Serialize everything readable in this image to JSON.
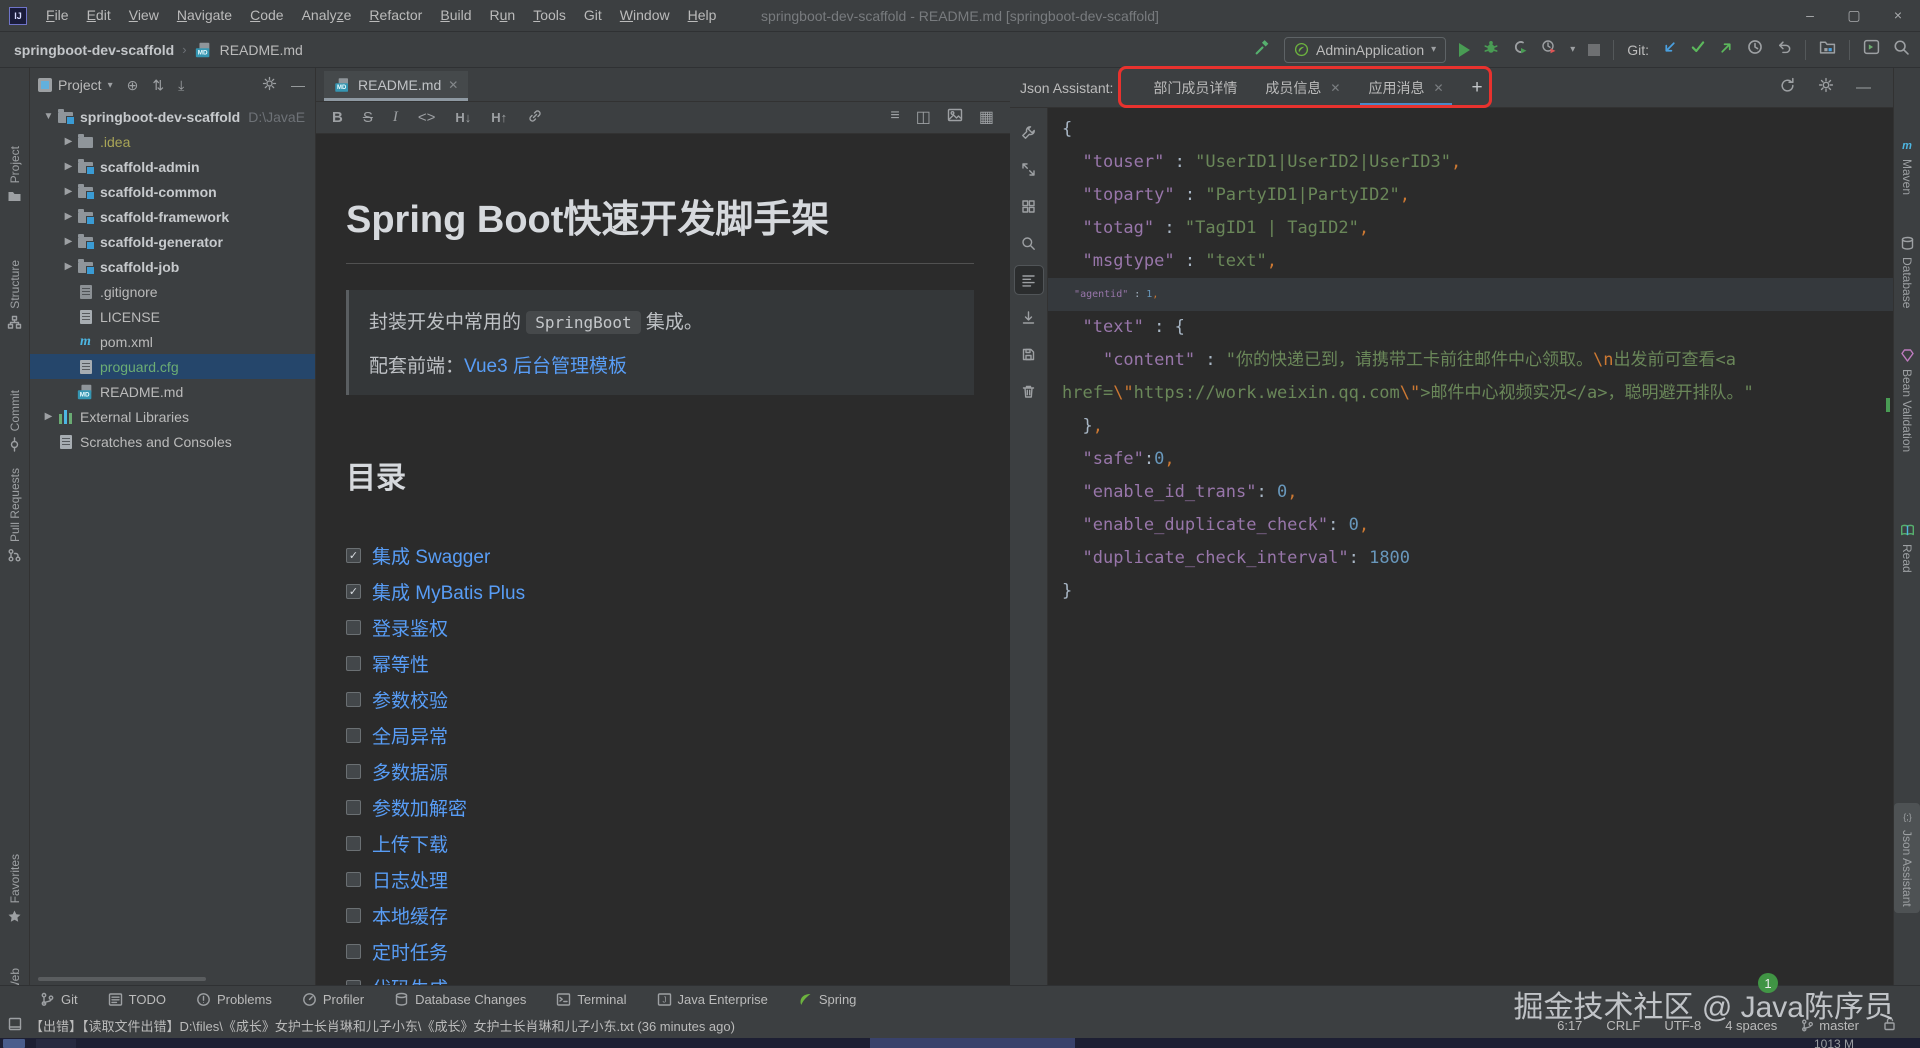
{
  "title_bar": {
    "logo": "IJ",
    "menus": [
      {
        "label": "File",
        "m": 0
      },
      {
        "label": "Edit",
        "m": 0
      },
      {
        "label": "View",
        "m": 0
      },
      {
        "label": "Navigate",
        "m": 0
      },
      {
        "label": "Code",
        "m": 0
      },
      {
        "label": "Analyze",
        "m": 5
      },
      {
        "label": "Refactor",
        "m": 0
      },
      {
        "label": "Build",
        "m": 0
      },
      {
        "label": "Run",
        "m": 1
      },
      {
        "label": "Tools",
        "m": 0
      },
      {
        "label": "Git",
        "m": -1
      },
      {
        "label": "Window",
        "m": 0
      },
      {
        "label": "Help",
        "m": 0
      }
    ],
    "title": "springboot-dev-scaffold - README.md [springboot-dev-scaffold]"
  },
  "toolbar": {
    "breadcrumb_project": "springboot-dev-scaffold",
    "breadcrumb_file": "README.md",
    "run_config": "AdminApplication",
    "git_label": "Git:"
  },
  "left_strip": {
    "items": [
      {
        "label": "Project",
        "icon": "project-folder-icon"
      },
      {
        "label": "Structure",
        "icon": "structure-icon"
      },
      {
        "label": "Commit",
        "icon": "commit-icon"
      },
      {
        "label": "Pull Requests",
        "icon": "pull-requests-icon"
      },
      {
        "label": "Favorites",
        "icon": "star-icon"
      },
      {
        "label": "Web",
        "icon": "globe-icon"
      }
    ]
  },
  "project_panel": {
    "title": "Project",
    "tree": [
      {
        "label": "springboot-dev-scaffold",
        "suffix": "D:\\JavaE",
        "icon": "module-folder",
        "chevron": "open",
        "indent": 0,
        "bold": true
      },
      {
        "label": ".idea",
        "icon": "folder",
        "chevron": "closed",
        "indent": 1,
        "state": "excluded"
      },
      {
        "label": "scaffold-admin",
        "icon": "module-folder",
        "chevron": "closed",
        "indent": 1,
        "bold": true
      },
      {
        "label": "scaffold-common",
        "icon": "module-folder",
        "chevron": "closed",
        "indent": 1,
        "bold": true
      },
      {
        "label": "scaffold-framework",
        "icon": "module-folder",
        "chevron": "closed",
        "indent": 1,
        "bold": true
      },
      {
        "label": "scaffold-generator",
        "icon": "module-folder",
        "chevron": "closed",
        "indent": 1,
        "bold": true
      },
      {
        "label": "scaffold-job",
        "icon": "module-folder",
        "chevron": "closed",
        "indent": 1,
        "bold": true
      },
      {
        "label": ".gitignore",
        "icon": "ignored-file",
        "indent": 1
      },
      {
        "label": "LICENSE",
        "icon": "text-file",
        "indent": 1
      },
      {
        "label": "pom.xml",
        "icon": "maven-file",
        "indent": 1
      },
      {
        "label": "proguard.cfg",
        "icon": "text-file",
        "indent": 1,
        "selected": true,
        "state": "vcs-added"
      },
      {
        "label": "README.md",
        "icon": "md-file",
        "indent": 1
      },
      {
        "label": "External Libraries",
        "icon": "libraries",
        "chevron": "closed",
        "indent": 0
      },
      {
        "label": "Scratches and Consoles",
        "icon": "scratches",
        "indent": 0
      }
    ]
  },
  "editor": {
    "tab_label": "README.md",
    "heading": "Spring Boot快速开发脚手架",
    "quote": {
      "line1_prefix": "封装开发中常用的 ",
      "code": "SpringBoot",
      "line1_suffix": " 集成。",
      "line2_prefix": "配套前端：",
      "line2_link": "Vue3 后台管理模板"
    },
    "toc_heading": "目录",
    "toc_items": [
      {
        "label": "集成 Swagger",
        "checked": true
      },
      {
        "label": "集成 MyBatis Plus",
        "checked": true
      },
      {
        "label": "登录鉴权",
        "checked": false
      },
      {
        "label": "幂等性",
        "checked": false
      },
      {
        "label": "参数校验",
        "checked": false
      },
      {
        "label": "全局异常",
        "checked": false
      },
      {
        "label": "多数据源",
        "checked": false
      },
      {
        "label": "参数加解密",
        "checked": false
      },
      {
        "label": "上传下载",
        "checked": false
      },
      {
        "label": "日志处理",
        "checked": false
      },
      {
        "label": "本地缓存",
        "checked": false
      },
      {
        "label": "定时任务",
        "checked": false
      },
      {
        "label": "代码生成",
        "checked": false
      }
    ]
  },
  "json_panel": {
    "title": "Json Assistant:",
    "tabs": [
      {
        "label": "部门成员详情",
        "closable": false,
        "active": false
      },
      {
        "label": "成员信息",
        "closable": true,
        "active": false
      },
      {
        "label": "应用消息",
        "closable": true,
        "active": true
      }
    ],
    "code": {
      "caret_line": 5,
      "lines": [
        [
          {
            "s": "p",
            "t": "{"
          }
        ],
        [
          {
            "s": "p",
            "t": "  "
          },
          {
            "s": "k",
            "t": "\"touser\""
          },
          {
            "s": "p",
            "t": " : "
          },
          {
            "s": "s",
            "t": "\"UserID1|UserID2|UserID3\""
          },
          {
            "s": "o",
            "t": ","
          }
        ],
        [
          {
            "s": "p",
            "t": "  "
          },
          {
            "s": "k",
            "t": "\"toparty\""
          },
          {
            "s": "p",
            "t": " : "
          },
          {
            "s": "s",
            "t": "\"PartyID1|PartyID2\""
          },
          {
            "s": "o",
            "t": ","
          }
        ],
        [
          {
            "s": "p",
            "t": "  "
          },
          {
            "s": "k",
            "t": "\"totag\""
          },
          {
            "s": "p",
            "t": " : "
          },
          {
            "s": "s",
            "t": "\"TagID1 | TagID2\""
          },
          {
            "s": "o",
            "t": ","
          }
        ],
        [
          {
            "s": "p",
            "t": "  "
          },
          {
            "s": "k",
            "t": "\"msgtype\""
          },
          {
            "s": "p",
            "t": " : "
          },
          {
            "s": "s",
            "t": "\"text\""
          },
          {
            "s": "o",
            "t": ","
          }
        ],
        [
          {
            "s": "p",
            "t": "  "
          },
          {
            "s": "k",
            "t": "\"agentid\""
          },
          {
            "s": "p",
            "t": " : "
          },
          {
            "s": "n",
            "t": "1"
          },
          {
            "s": "o",
            "t": ","
          }
        ],
        [
          {
            "s": "p",
            "t": "  "
          },
          {
            "s": "k",
            "t": "\"text\""
          },
          {
            "s": "p",
            "t": " : {"
          }
        ],
        [
          {
            "s": "p",
            "t": "    "
          },
          {
            "s": "k",
            "t": "\"content\""
          },
          {
            "s": "p",
            "t": " : "
          },
          {
            "s": "s",
            "t": "\"你的快递已到，请携带工卡前往邮件中心领取。"
          },
          {
            "s": "e",
            "t": "\\n"
          },
          {
            "s": "s",
            "t": "出发前可查看<a href="
          },
          {
            "s": "e",
            "t": "\\\""
          },
          {
            "s": "s",
            "t": "https://work.weixin.qq.com"
          },
          {
            "s": "e",
            "t": "\\\""
          },
          {
            "s": "s",
            "t": ">邮件中心视频实况</a>，聪明避开排队。\""
          }
        ],
        [
          {
            "s": "p",
            "t": "  }"
          },
          {
            "s": "o",
            "t": ","
          }
        ],
        [
          {
            "s": "p",
            "t": "  "
          },
          {
            "s": "k",
            "t": "\"safe\""
          },
          {
            "s": "p",
            "t": ":"
          },
          {
            "s": "n",
            "t": "0"
          },
          {
            "s": "o",
            "t": ","
          }
        ],
        [
          {
            "s": "p",
            "t": "  "
          },
          {
            "s": "k",
            "t": "\"enable_id_trans\""
          },
          {
            "s": "p",
            "t": ": "
          },
          {
            "s": "n",
            "t": "0"
          },
          {
            "s": "o",
            "t": ","
          }
        ],
        [
          {
            "s": "p",
            "t": "  "
          },
          {
            "s": "k",
            "t": "\"enable_duplicate_check\""
          },
          {
            "s": "p",
            "t": ": "
          },
          {
            "s": "n",
            "t": "0"
          },
          {
            "s": "o",
            "t": ","
          }
        ],
        [
          {
            "s": "p",
            "t": "  "
          },
          {
            "s": "k",
            "t": "\"duplicate_check_interval\""
          },
          {
            "s": "p",
            "t": ": "
          },
          {
            "s": "n",
            "t": "1800"
          }
        ],
        [
          {
            "s": "p",
            "t": "}"
          }
        ]
      ]
    },
    "tool_icons": [
      "wrench-icon",
      "expand-icon",
      "panes-icon",
      "search-icon",
      "format-lines-icon",
      "import-icon",
      "save-icon",
      "trash-icon"
    ],
    "selected_tool": 4
  },
  "right_strip": {
    "items": [
      {
        "label": "Maven",
        "icon": "maven-icon"
      },
      {
        "label": "Database",
        "icon": "database-icon"
      },
      {
        "label": "Bean Validation",
        "icon": "bean-validation-icon"
      },
      {
        "label": "Read",
        "icon": "book-icon"
      },
      {
        "label": "Json Assistant",
        "icon": "json-braces-icon",
        "active": true
      }
    ]
  },
  "status_bar": {
    "tools": [
      {
        "label": "Git",
        "icon": "git-branch-icon"
      },
      {
        "label": "TODO",
        "icon": "todo-list-icon"
      },
      {
        "label": "Problems",
        "icon": "problems-icon"
      },
      {
        "label": "Profiler",
        "icon": "profiler-gauge-icon"
      },
      {
        "label": "Database Changes",
        "icon": "database-icon"
      },
      {
        "label": "Terminal",
        "icon": "terminal-icon"
      },
      {
        "label": "Java Enterprise",
        "icon": "java-enterprise-icon"
      },
      {
        "label": "Spring",
        "icon": "spring-leaf-icon"
      }
    ],
    "message": "【出错】【读取文件出错】D:\\files\\《成长》女护士长肖琳和儿子小东\\《成长》女护士长肖琳和儿子小东.txt (36 minutes ago)",
    "caret_position": "6:17",
    "line_separator": "CRLF",
    "encoding": "UTF-8",
    "indent": "4 spaces",
    "branch": "master"
  },
  "watermark": {
    "text": "掘金技术社区 @ Java陈序员",
    "badge": "1"
  },
  "taskbar": {
    "corner_text": "1013 M"
  },
  "colors": {
    "accent_blue": "#4a88c7",
    "run_green": "#499c54",
    "annotation_red": "#e8322e",
    "link": "#589df6"
  }
}
